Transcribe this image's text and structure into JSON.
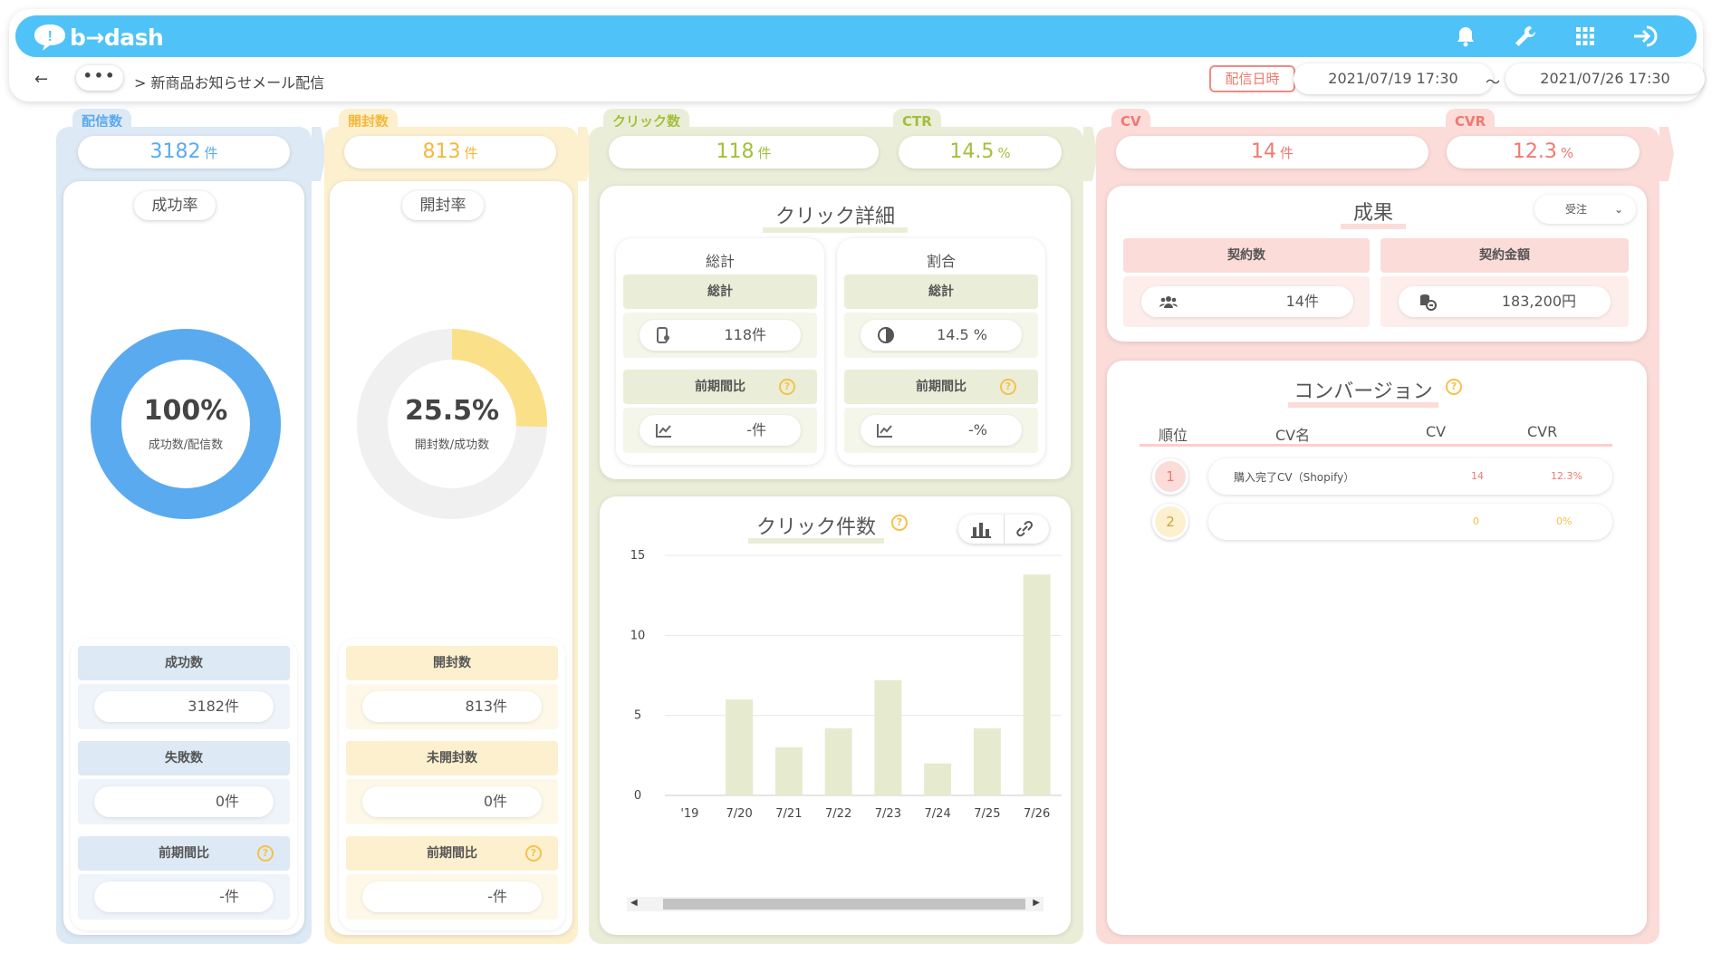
{
  "app": {
    "logo": "b→dash"
  },
  "topbar_icons": [
    "bell-icon",
    "wrench-icon",
    "grid-icon",
    "logout-icon"
  ],
  "breadcrumb": {
    "back": "←",
    "more": "•••",
    "separator": ">",
    "current": "新商品お知らせメール配信"
  },
  "date_range": {
    "label": "配信日時",
    "start": "2021/07/19 17:30",
    "tilde": "〜",
    "end": "2021/07/26 17:30"
  },
  "delivery": {
    "tab": "配信数",
    "count": "3182",
    "unit": "件",
    "rate_title": "成功率",
    "rate": "100%",
    "rate_sub": "成功数/配信数",
    "rate_value": 1.0,
    "success_label": "成功数",
    "success_value": "3182件",
    "fail_label": "失敗数",
    "fail_value": "0件",
    "prev_label": "前期間比",
    "prev_value": "-件"
  },
  "open": {
    "tab": "開封数",
    "count": "813",
    "unit": "件",
    "rate_title": "開封率",
    "rate": "25.5%",
    "rate_sub": "開封数/成功数",
    "rate_value": 0.255,
    "open_label": "開封数",
    "open_value": "813件",
    "unopened_label": "未開封数",
    "unopened_value": "0件",
    "prev_label": "前期間比",
    "prev_value": "-件"
  },
  "click": {
    "tab": "クリック数",
    "count": "118",
    "unit": "件",
    "ctr_tab": "CTR",
    "ctr": "14.5",
    "ctr_unit": "%",
    "detail_title": "クリック詳細",
    "total_head": "総計",
    "ratio_head": "割合",
    "total_sub": "総計",
    "total_value": "118件",
    "ratio_sub": "総計",
    "ratio_value": "14.5 %",
    "prev_label": "前期間比",
    "prev_total": "-件",
    "prev_ratio": "-%",
    "chart_title": "クリック件数"
  },
  "cv": {
    "tab": "CV",
    "count": "14",
    "unit": "件",
    "cvr_tab": "CVR",
    "cvr": "12.3",
    "cvr_unit": "%",
    "results_title": "成果",
    "select_value": "受注",
    "contract_label": "契約数",
    "contract_value": "14件",
    "amount_label": "契約金額",
    "amount_value": "183,200円",
    "conv_title": "コンバージョン",
    "headers": {
      "rank": "順位",
      "name": "CV名",
      "cv": "CV",
      "cvr": "CVR"
    },
    "rows": [
      {
        "rank": "1",
        "name": "購入完了CV（Shopify）",
        "cv": "14",
        "cvr": "12.3%"
      },
      {
        "rank": "2",
        "name": "",
        "cv": "0",
        "cvr": "0%"
      }
    ]
  },
  "colors": {
    "blue": "#5aaaf0",
    "yellow": "#f5c14a",
    "green": "#a3bf3a",
    "pink": "#f07a70",
    "header": "#4fc3f7"
  },
  "chart_data": {
    "type": "bar",
    "categories": [
      "'19",
      "7/20",
      "7/21",
      "7/22",
      "7/23",
      "7/24",
      "7/25",
      "7/26"
    ],
    "values": [
      0,
      6,
      3,
      4.2,
      7.2,
      2,
      4.2,
      13.8
    ],
    "ylim": [
      0,
      15
    ],
    "yticks": [
      0,
      5,
      10,
      15
    ]
  }
}
